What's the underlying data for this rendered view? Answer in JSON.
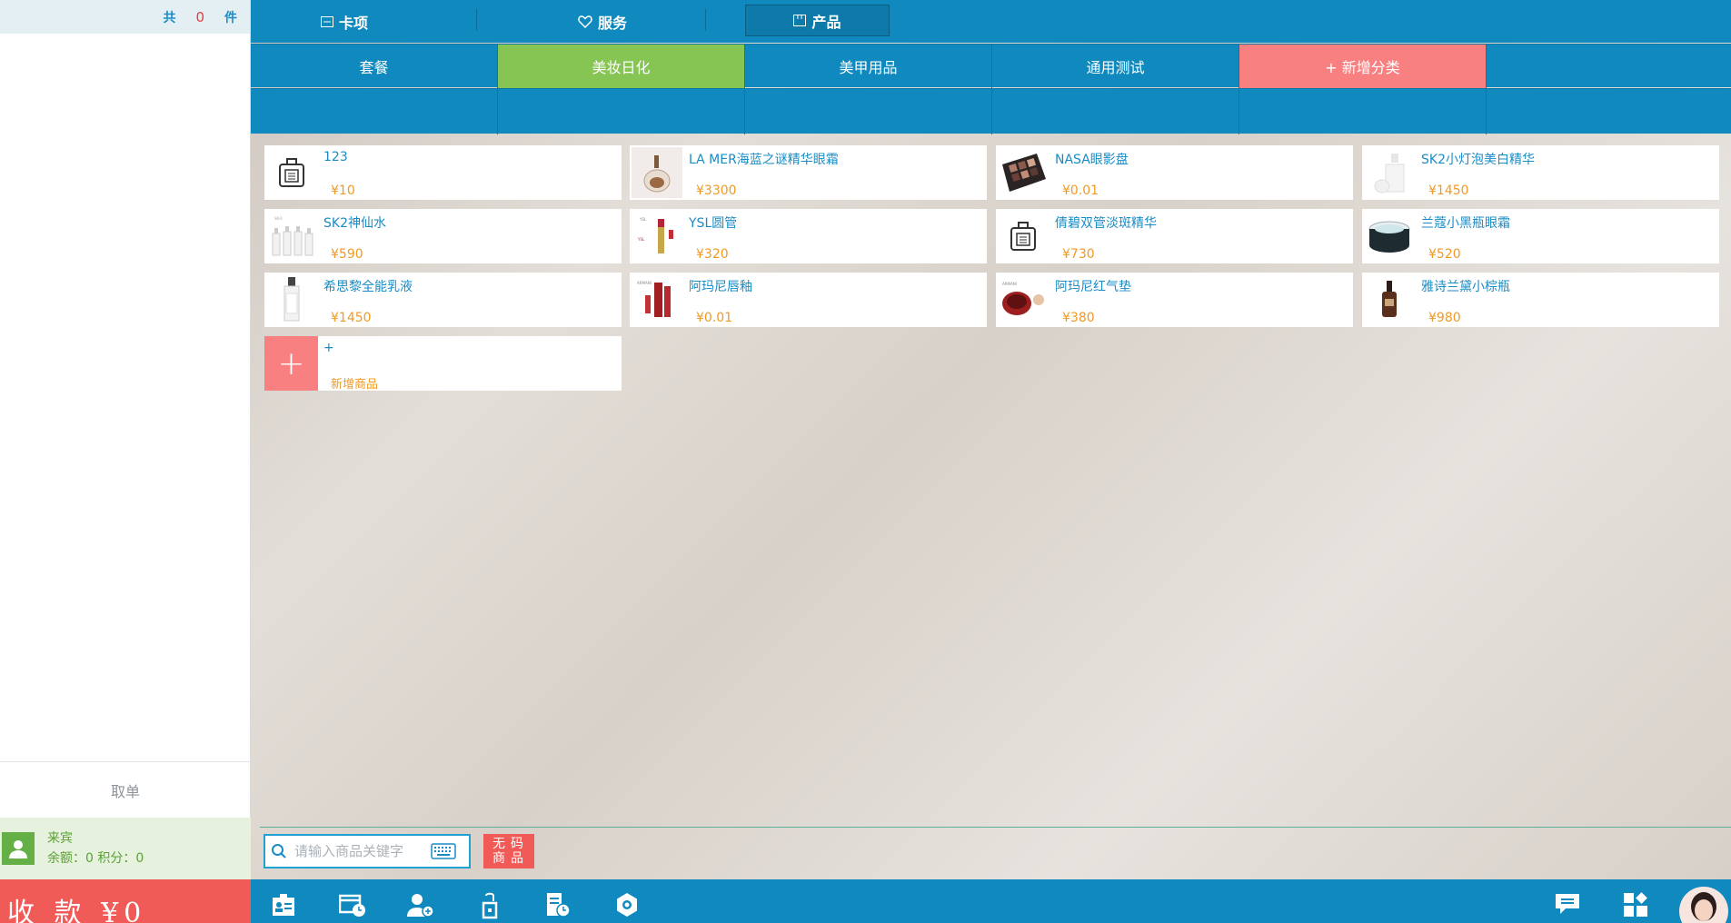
{
  "cart": {
    "total_prefix": "共",
    "count": "0",
    "unit": "件"
  },
  "cancel_label": "取单",
  "member": {
    "name": "来宾",
    "balance_line": "余额：0  积分：0"
  },
  "pay": {
    "label": "收 款 ¥0"
  },
  "top_tabs": [
    {
      "label": "卡项",
      "icon": "card-icon"
    },
    {
      "label": "服务",
      "icon": "heart-icon"
    },
    {
      "label": "产品",
      "icon": "box-icon",
      "active": true
    }
  ],
  "categories": [
    {
      "label": "套餐"
    },
    {
      "label": "美妆日化",
      "active": true
    },
    {
      "label": "美甲用品"
    },
    {
      "label": "通用测试"
    },
    {
      "label": "+ 新增分类"
    }
  ],
  "products": [
    {
      "name": "123",
      "price": "¥10",
      "icon": "perfume-bottle-icon"
    },
    {
      "name": "LA MER海蓝之谜精华眼霜",
      "price": "¥3300",
      "icon": "cream-jar-image"
    },
    {
      "name": "NASA眼影盘",
      "price": "¥0.01",
      "icon": "eyeshadow-palette-image"
    },
    {
      "name": "SK2小灯泡美白精华",
      "price": "¥1450",
      "icon": "serum-bottle-image"
    },
    {
      "name": "SK2神仙水",
      "price": "¥590",
      "icon": "essence-bottles-image"
    },
    {
      "name": "YSL圆管",
      "price": "¥320",
      "icon": "lipstick-image"
    },
    {
      "name": "倩碧双管淡斑精华",
      "price": "¥730",
      "icon": "perfume-bottle-icon"
    },
    {
      "name": "兰蔻小黑瓶眼霜",
      "price": "¥520",
      "icon": "eye-cream-jar-image"
    },
    {
      "name": "希思黎全能乳液",
      "price": "¥1450",
      "icon": "lotion-bottle-image"
    },
    {
      "name": "阿玛尼唇釉",
      "price": "¥0.01",
      "icon": "lip-gloss-image"
    },
    {
      "name": "阿玛尼红气垫",
      "price": "¥380",
      "icon": "cushion-compact-image"
    },
    {
      "name": "雅诗兰黛小棕瓶",
      "price": "¥980",
      "icon": "brown-bottle-image"
    }
  ],
  "add_product": {
    "name": "+",
    "label": "新增商品"
  },
  "search": {
    "placeholder": "请输入商品关键字"
  },
  "nocode_button": {
    "label": "无码商品"
  },
  "toolbar": [
    "member-card-icon",
    "calendar-clock-icon",
    "add-member-icon",
    "tag-icon",
    "document-clock-icon",
    "settings-icon"
  ],
  "right_toolbar": [
    "message-icon",
    "apps-icon",
    "user-avatar"
  ],
  "colors": {
    "primary": "#0f89be",
    "active_category": "#86c453",
    "add_category": "#f98080",
    "price": "#f09a25",
    "pay": "#f05a57"
  }
}
